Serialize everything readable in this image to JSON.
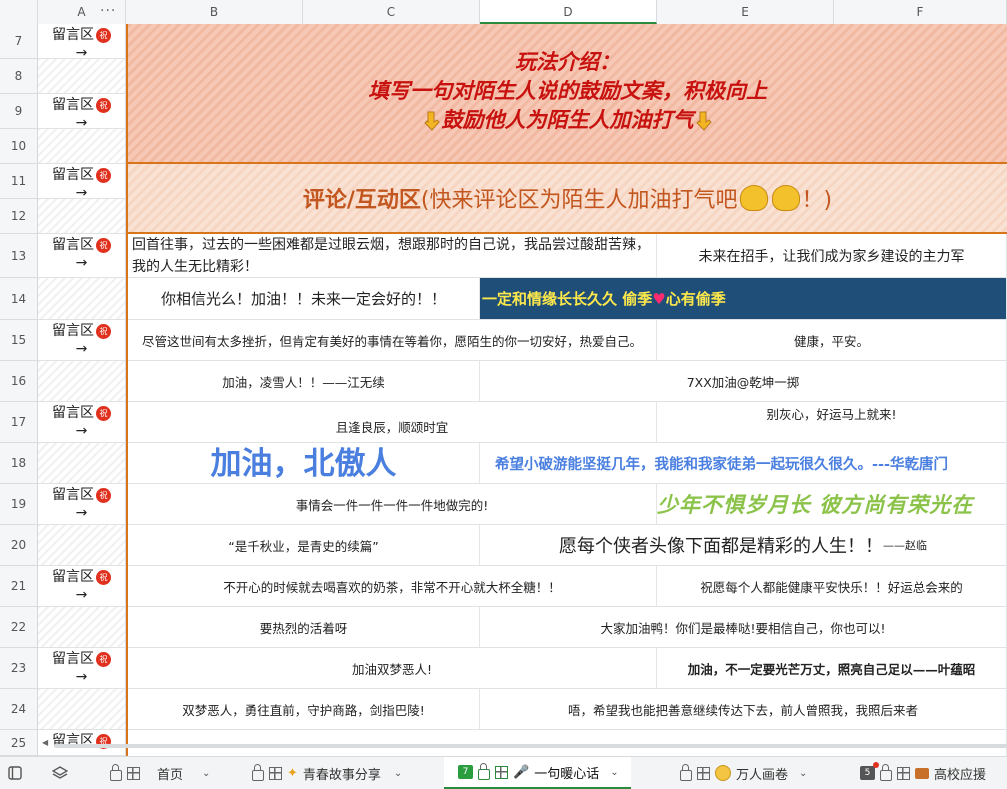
{
  "columns": [
    "A",
    "B",
    "C",
    "D",
    "E",
    "F"
  ],
  "row_numbers": [
    "7",
    "8",
    "9",
    "10",
    "11",
    "12",
    "13",
    "14",
    "15",
    "16",
    "17",
    "18",
    "19",
    "20",
    "21",
    "22",
    "23",
    "24",
    "25"
  ],
  "a_column": {
    "label": "留言区",
    "arrow": "→",
    "badge": "祝"
  },
  "intro": {
    "line1": "玩法介绍：",
    "line2": "填写一句对陌生人说的鼓励文案，积极向上",
    "line3": "鼓励他人为陌生人加油打气"
  },
  "comment_header": {
    "bold": "评论/互动区",
    "rest": "(快来评论区为陌生人加油打气吧",
    "end": "！)"
  },
  "messages": {
    "r13_left": "回首往事，过去的一些困难都是过眼云烟，想跟那时的自己说，我品尝过酸甜苦辣，我的人生无比精彩！",
    "r13_right": "未来在招手，让我们成为家乡建设的主力军",
    "r14_left": "你相信光么！加油！！未来一定会好的！！",
    "r14_right_a": "一定和情缘长长久久  偷季",
    "r14_right_heart": "♥",
    "r14_right_b": "心有偷季",
    "r15_left": "尽管这世间有太多挫折，但肯定有美好的事情在等着你，愿陌生的你一切安好，热爱自己。",
    "r15_right": "健康，平安。",
    "r16_left": "加油，凌雪人！！——江无续",
    "r16_right": "7XX加油@乾坤一掷",
    "r17_left": "且逢良辰，顺颂时宜",
    "r17_right": "别灰心，好运马上就来!",
    "r18_left": "加油，北傲人",
    "r18_right": "希望小破游能坚挺几年，我能和我家徒弟一起玩很久很久。---华乾唐门",
    "r19_left": "事情会一件一件一件一件地做完的!",
    "r19_right": "少年不惧岁月长  彼方尚有荣光在",
    "r20_left": "“是千秋业，是青史的续篇”",
    "r20_right": "愿每个侠者头像下面都是精彩的人生！！",
    "r20_right_sig": "——赵临",
    "r21_left": "不开心的时候就去喝喜欢的奶茶，非常不开心就大杯全糖！！",
    "r21_right": "祝愿每个人都能健康平安快乐！！好运总会来的",
    "r22_left": "要热烈的活着呀",
    "r22_right": "大家加油鸭！你们是最棒哒!要相信自己，你也可以!",
    "r23_left": "加油双梦恶人!",
    "r23_right": "加油，不一定要光芒万丈，照亮自己足以——叶蕴昭",
    "r24_left": "双梦恶人，勇往直前，守护商路，剑指巴陵!",
    "r24_right": "唔，希望我也能把善意继续传达下去，前人曾照我，我照后来者"
  },
  "tabs": {
    "home": "首页",
    "youth": "青春故事分享",
    "active_count": "7",
    "active": "一句暖心话",
    "wanren": "万人画卷",
    "gray_count": "5",
    "college": "高校应援"
  },
  "colors": {
    "accent_orange": "#d8741a",
    "intro_red": "#c8120f",
    "navy": "#1f4e79",
    "blue_text": "#4a7fe0",
    "green_text": "#8bc34a"
  }
}
